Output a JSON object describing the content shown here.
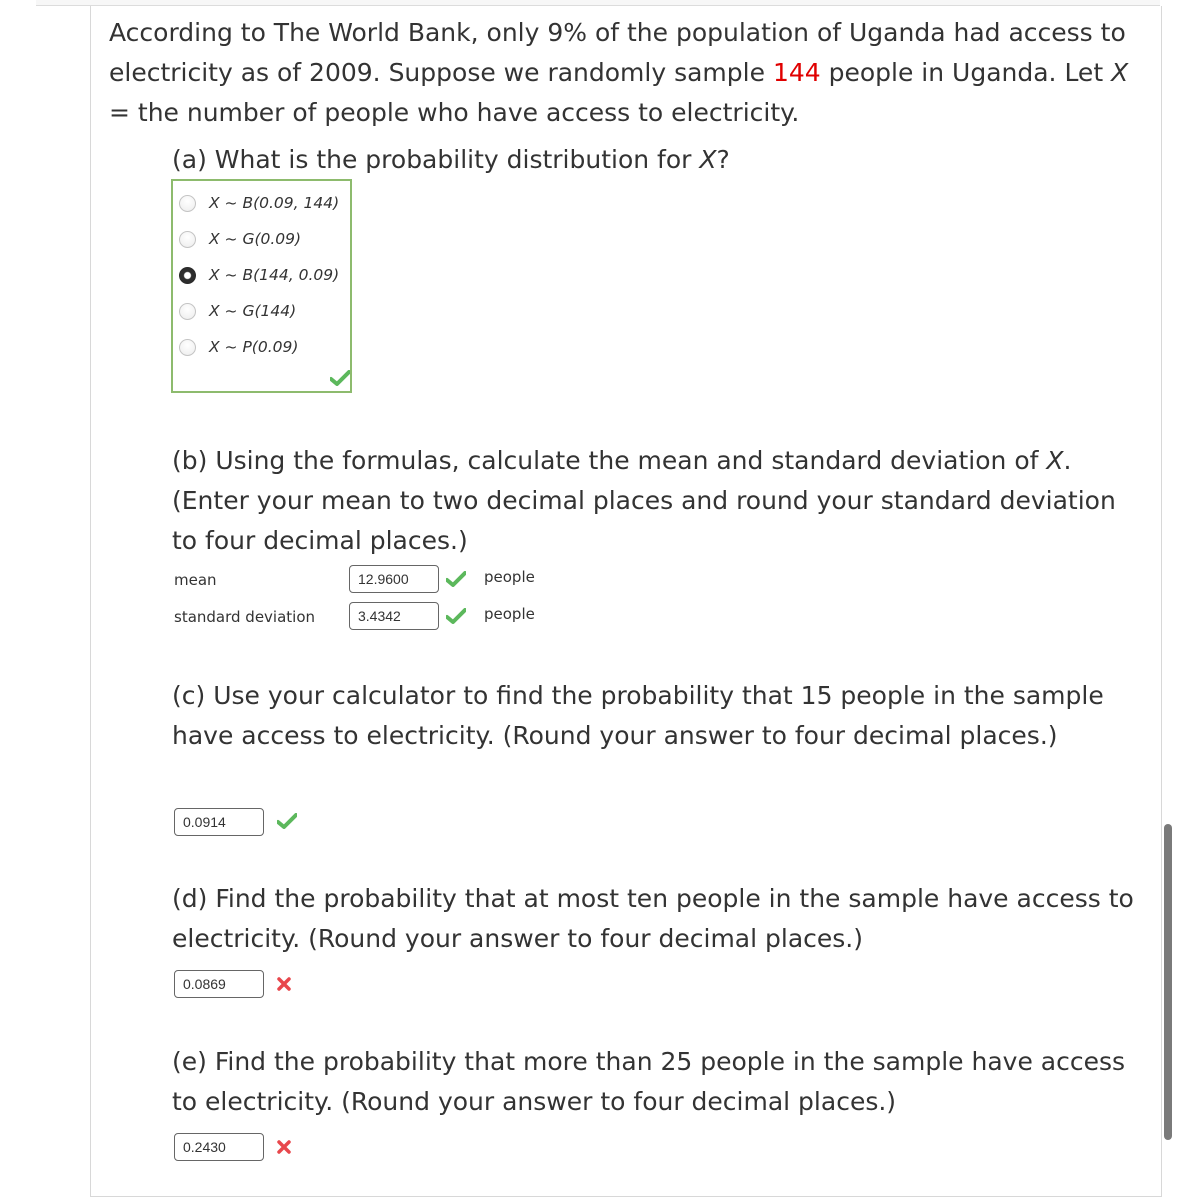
{
  "intro": {
    "part1": "According to The World Bank, only 9% of the population of Uganda had access to electricity as of 2009. Suppose we randomly sample ",
    "highlight": "144",
    "part2": " people in Uganda. Let ",
    "var": "X",
    "part3": " = the number of people who have access to electricity."
  },
  "part_a": {
    "question_pre": "(a) What is the probability distribution for ",
    "question_var": "X",
    "question_post": "?",
    "options": [
      {
        "label": "X ~ B(0.09, 144)",
        "selected": false
      },
      {
        "label": "X ~ G(0.09)",
        "selected": false
      },
      {
        "label": "X ~ B(144, 0.09)",
        "selected": true
      },
      {
        "label": "X ~ G(144)",
        "selected": false
      },
      {
        "label": "X ~ P(0.09)",
        "selected": false
      }
    ],
    "status": "correct"
  },
  "part_b": {
    "question_pre": "(b) Using the formulas, calculate the mean and standard deviation of ",
    "question_var": "X",
    "question_post": ". (Enter your mean to two decimal places and round your standard deviation to four decimal places.)",
    "mean_label": "mean",
    "mean_value": "12.9600",
    "mean_status": "correct",
    "mean_unit": "people",
    "sd_label": "standard deviation",
    "sd_value": "3.4342",
    "sd_status": "correct",
    "sd_unit": "people"
  },
  "part_c": {
    "question": "(c) Use your calculator to find the probability that 15 people in the sample have access to electricity. (Round your answer to four decimal places.)",
    "value": "0.0914",
    "status": "correct"
  },
  "part_d": {
    "question": "(d) Find the probability that at most ten people in the sample have access to electricity. (Round your answer to four decimal places.)",
    "value": "0.0869",
    "status": "incorrect"
  },
  "part_e": {
    "question": "(e) Find the probability that more than 25 people in the sample have access to electricity. (Round your answer to four decimal places.)",
    "value": "0.2430",
    "status": "incorrect"
  },
  "colors": {
    "highlight": "#e00000",
    "correct": "#5cb85c",
    "incorrect": "#e8474c",
    "box_border_correct": "#8dbb6d"
  }
}
